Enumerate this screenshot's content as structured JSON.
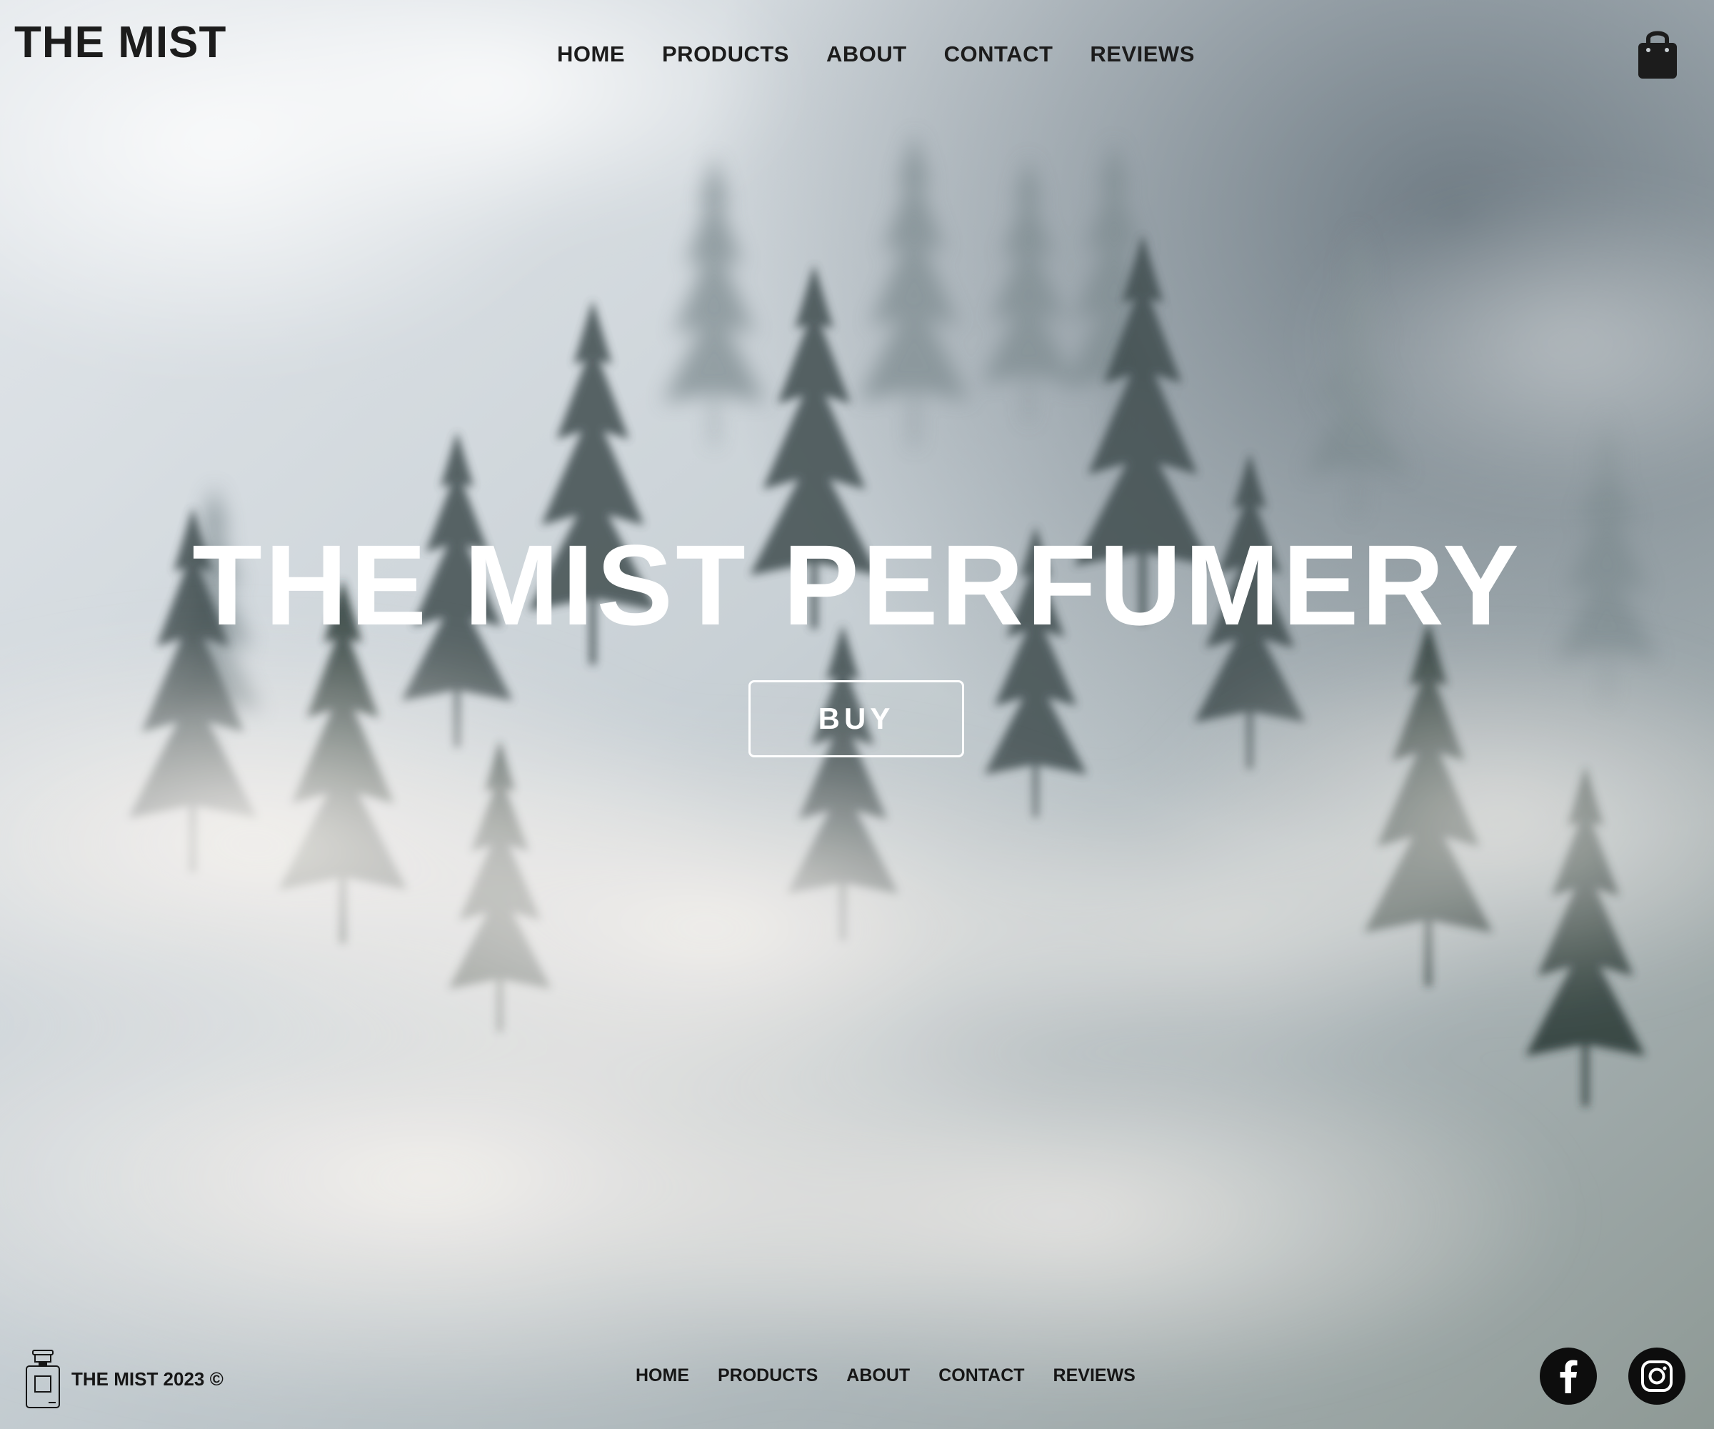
{
  "header": {
    "logo": "THE MIST",
    "nav": [
      "HOME",
      "PRODUCTS",
      "ABOUT",
      "CONTACT",
      "REVIEWS"
    ]
  },
  "hero": {
    "title": "THE MIST PERFUMERY",
    "button_label": "BUY"
  },
  "footer": {
    "copyright": "THE MIST 2023 ©",
    "nav": [
      "HOME",
      "PRODUCTS",
      "ABOUT",
      "CONTACT",
      "REVIEWS"
    ]
  },
  "icons": {
    "cart": "shopping-bag-icon",
    "bottle": "perfume-bottle-icon",
    "facebook": "facebook-icon",
    "instagram": "instagram-icon"
  },
  "colors": {
    "text_dark": "#1c1c1c",
    "hero_text": "#ffffff",
    "social_bg": "#0d0d0d"
  }
}
